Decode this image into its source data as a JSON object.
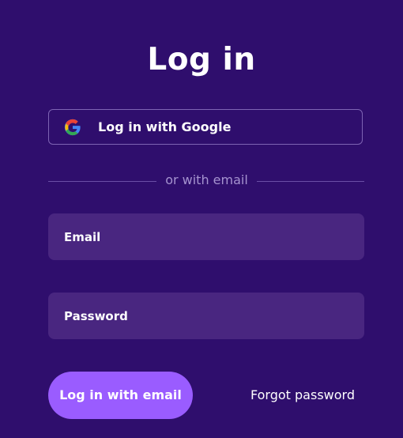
{
  "header": {
    "title": "Log in"
  },
  "google_login": {
    "label": "Log in with Google",
    "icon": "google-icon",
    "colors": {
      "blue": "#4285F4",
      "red": "#EA4335",
      "yellow": "#FBBC05",
      "green": "#34A853"
    }
  },
  "divider": {
    "text": "or with email"
  },
  "form": {
    "email_placeholder": "Email",
    "password_placeholder": "Password",
    "submit_label": "Log in with email",
    "forgot_label": "Forgot password"
  },
  "theme": {
    "background": "#2f0e6d",
    "field_background": "#492680",
    "accent": "#9a5cff",
    "border": "#7e64b3",
    "muted_text": "#a593cf"
  }
}
